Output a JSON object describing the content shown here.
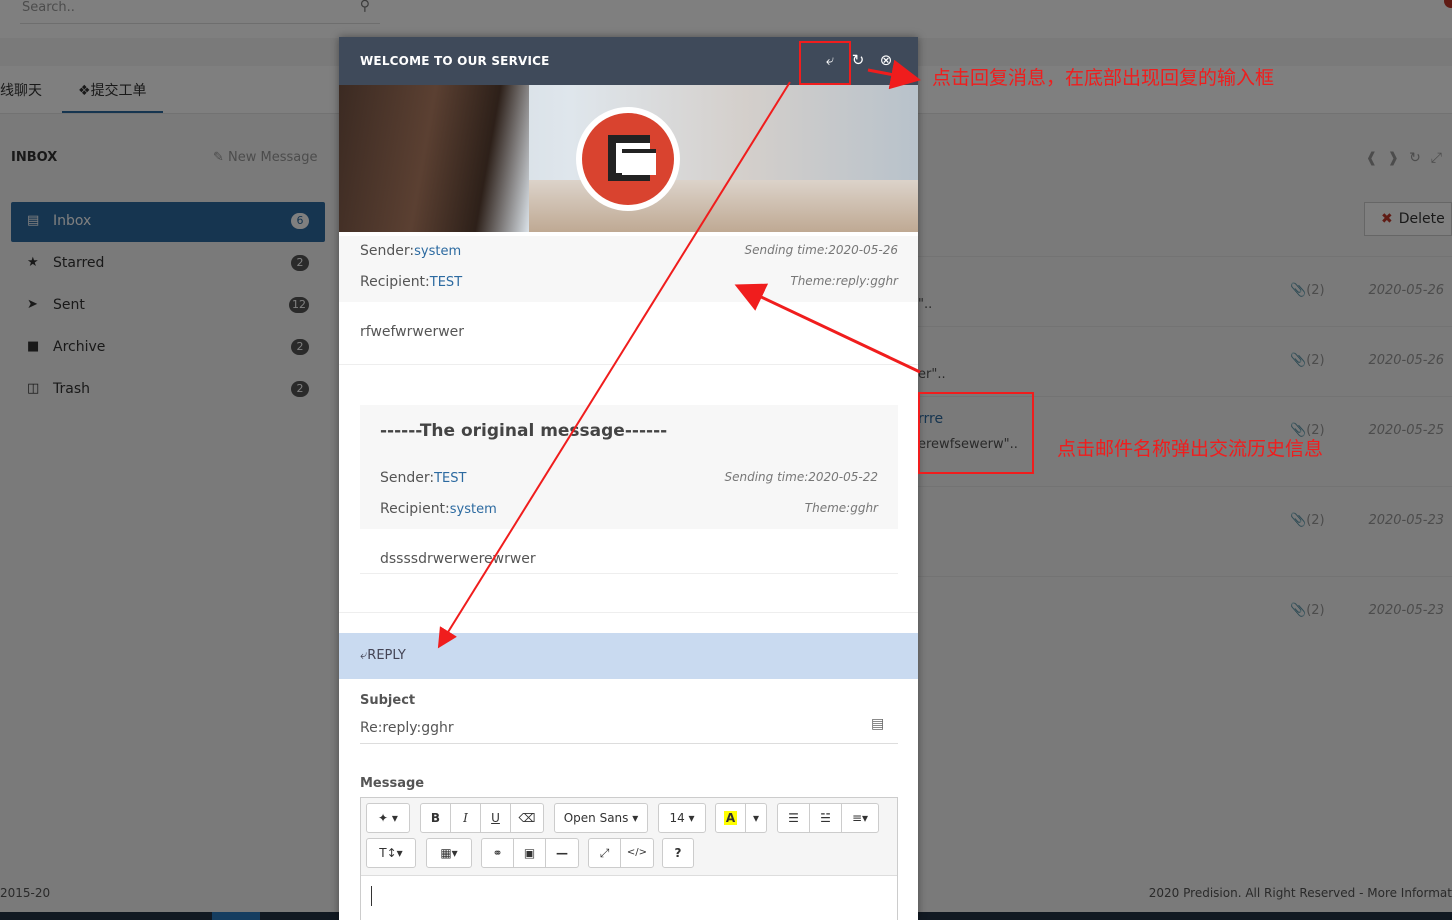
{
  "topbar": {
    "search_placeholder": "Search.."
  },
  "tabs": [
    {
      "label": "在线聊天"
    },
    {
      "label": "提交工单"
    }
  ],
  "inbox": {
    "title": "INBOX",
    "new_message": "New Message"
  },
  "sidebar": {
    "items": [
      {
        "label": "Inbox",
        "count": "6",
        "icon": "inbox-icon"
      },
      {
        "label": "Starred",
        "count": "2",
        "icon": "star-icon"
      },
      {
        "label": "Sent",
        "count": "12",
        "icon": "paper-plane-icon"
      },
      {
        "label": "Archive",
        "count": "2",
        "icon": "folder-icon"
      },
      {
        "label": "Trash",
        "count": "2",
        "icon": "trash-icon"
      }
    ]
  },
  "mail_list": {
    "delete_label": "Delete",
    "rows": [
      {
        "preview": "\"..",
        "attachments": "(2)",
        "date": "2020-05-26"
      },
      {
        "preview": "er\"..",
        "attachments": "(2)",
        "date": "2020-05-26"
      },
      {
        "subject": "rrre",
        "preview": "erewfsewerw\"..",
        "attachments": "(2)",
        "date": "2020-05-25"
      },
      {
        "attachments": "(2)",
        "date": "2020-05-23"
      },
      {
        "attachments": "(2)",
        "date": "2020-05-23"
      }
    ]
  },
  "footer": {
    "left": "2015-20",
    "right": "2020 Predision. All Right Reserved - More Informat"
  },
  "modal": {
    "title": "WELCOME TO OUR SERVICE",
    "sender_label": "Sender:",
    "sender": "system",
    "recipient_label": "Recipient:",
    "recipient": "TEST",
    "sending_time": "Sending time:2020-05-26",
    "theme": "Theme:reply:gghr",
    "body": "rfwefwrwerwer",
    "original": {
      "heading": "------The original message------",
      "sender_label": "Sender:",
      "sender": "TEST",
      "recipient_label": "Recipient:",
      "recipient": "system",
      "sending_time": "Sending time:2020-05-22",
      "theme": "Theme:gghr",
      "body": "dssssdrwerwerewrwer"
    },
    "reply": {
      "bar_label": "REPLY",
      "subject_label": "Subject",
      "subject_value": "Re:reply:gghr",
      "message_label": "Message",
      "toolbar": {
        "bold": "B",
        "italic": "I",
        "underline": "U",
        "font": "Open Sans",
        "size": "14",
        "color": "A",
        "help": "?"
      }
    }
  },
  "annotations": {
    "top": "点击回复消息，在底部出现回复的输入框",
    "middle": "点击邮件名称弹出交流历史信息"
  },
  "colors": {
    "header": "#3f4a5a",
    "accent": "#2c6aa0",
    "reply_bar": "#c9daf0",
    "annotation": "#f01d1d"
  }
}
